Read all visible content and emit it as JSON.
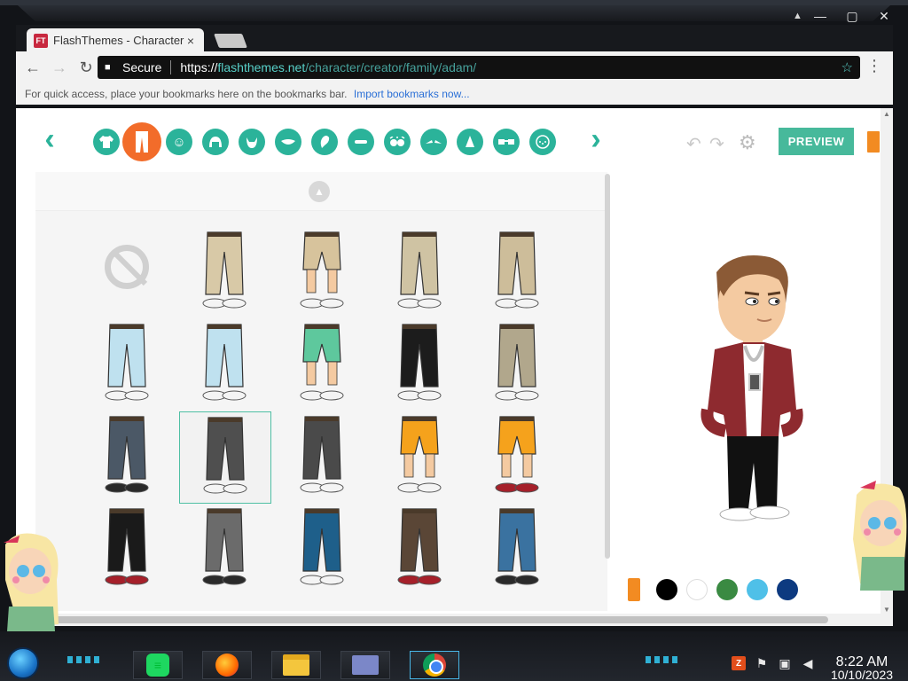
{
  "browser": {
    "tab_title": "FlashThemes - Character",
    "tab_close": "×",
    "favicon": "FT",
    "secure_label": "Secure",
    "url_scheme": "https://",
    "url_domain": "flashthemes.net",
    "url_path": "/character/creator/family/adam/",
    "bookmarks_text": "For quick access, place your bookmarks here on the bookmarks bar.",
    "bookmarks_link": "Import bookmarks now...",
    "icons": {
      "back": "←",
      "forward": "→",
      "reload": "↻",
      "star": "☆",
      "menu": "⋮",
      "lock": "🔒"
    }
  },
  "creator": {
    "preview_label": "PREVIEW",
    "categories": [
      "upper-body",
      "lower-body",
      "face",
      "hair",
      "beard",
      "mouth",
      "ear",
      "eyebrow-shape",
      "eyes",
      "eyebrows",
      "nose",
      "glasses",
      "freckles"
    ],
    "active_category": "lower-body",
    "pants_items": [
      {
        "name": "none",
        "color": ""
      },
      {
        "name": "khaki-pants-white-shoes",
        "color": "#d8c9a7"
      },
      {
        "name": "khaki-capri-sandals",
        "color": "#d7c39c"
      },
      {
        "name": "khaki-pants-white-sneakers",
        "color": "#cfc3a3"
      },
      {
        "name": "khaki-cargo-pants",
        "color": "#cdbd9a"
      },
      {
        "name": "light-blue-pants-grey-shoes",
        "color": "#bfe1ef"
      },
      {
        "name": "light-blue-pants-sandals",
        "color": "#bfe1ef"
      },
      {
        "name": "green-shorts-socks",
        "color": "#5ec89d"
      },
      {
        "name": "black-white-pants",
        "color": "#1c1c1c"
      },
      {
        "name": "camo-cargo-pants",
        "color": "#b1a78c"
      },
      {
        "name": "slate-pants-black-boots",
        "color": "#4b5866"
      },
      {
        "name": "dark-grey-pants-black-shoes",
        "color": "#4f4f4f"
      },
      {
        "name": "torn-grey-pants",
        "color": "#4a4a4a"
      },
      {
        "name": "orange-shorts-sneakers",
        "color": "#f5a21c"
      },
      {
        "name": "orange-shorts-red-sneakers",
        "color": "#f5a21c"
      },
      {
        "name": "black-pants-red-boots",
        "color": "#1a1a1a"
      },
      {
        "name": "grey-pants-black-boots",
        "color": "#6b6b6b"
      },
      {
        "name": "blue-jeans-white-shoes",
        "color": "#1e5f8a"
      },
      {
        "name": "brown-tattered-pants",
        "color": "#5a4636"
      },
      {
        "name": "jeans-brown-boots",
        "color": "#3a72a0"
      }
    ],
    "selected_item_index": 11,
    "color_swatches": [
      "#000000",
      "#ffffff",
      "#3a8a42",
      "#4fc0e8",
      "#0d3a80"
    ]
  },
  "taskbar": {
    "time": "8:22 AM",
    "date": "10/10/2023"
  }
}
